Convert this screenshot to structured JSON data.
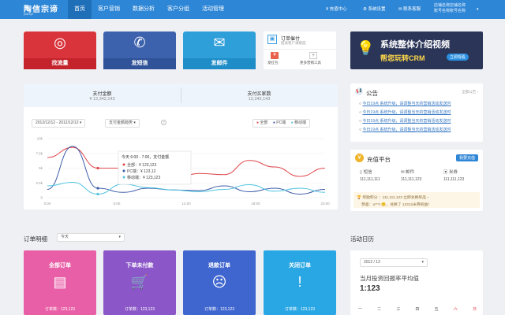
{
  "header": {
    "logo": "陶信宗谛",
    "logo_sub": "jintrepr",
    "nav": [
      "首页",
      "客户营销",
      "数据分析",
      "客户分组",
      "活动管理"
    ],
    "recharge": "充值中心",
    "settings": "系统设置",
    "contact": "联系客服",
    "user_line1": "店铺名称店铺名称",
    "user_line2": "账号名称账号名称"
  },
  "tiles": [
    {
      "label": "找流量",
      "color": "#d9343c"
    },
    {
      "label": "发短信",
      "color": "#3d62ad"
    },
    {
      "label": "发邮件",
      "color": "#2f9fd9"
    }
  ],
  "follow_card": {
    "title": "订单催付",
    "subtitle": "提高客户满意度",
    "item1": "发红包",
    "item2": "更多营销工具"
  },
  "promo": {
    "title": "系统整体介绍视频",
    "subtitle": "帮您玩转CRM",
    "button": "立即观看"
  },
  "stats": {
    "pay_amount_label": "支付金额",
    "pay_amount_value": "¥ 12,342,143",
    "buyers_label": "支付买家数",
    "buyers_value": "12,342,143"
  },
  "chart_controls": {
    "date_range": "2012/12/12 - 2012/12/12",
    "metric": "支付金额趋势",
    "legend": [
      "全部",
      "PC端",
      "移动端"
    ]
  },
  "chart_data": {
    "type": "line",
    "x": [
      "0:00",
      "6:00",
      "12:00",
      "18:00",
      "23:00"
    ],
    "y_ticks": [
      "0",
      "2.5k",
      "5k",
      "7.5k",
      "10k"
    ],
    "ylim": [
      0,
      10000
    ],
    "series": [
      {
        "name": "全部",
        "color": "#e0474c",
        "values": [
          6800,
          8500,
          5000,
          5000,
          3900,
          3000,
          4100,
          3900,
          6300,
          5200,
          3600,
          5000
        ]
      },
      {
        "name": "PC端",
        "color": "#3b5aa8",
        "values": [
          1400,
          8700,
          1600,
          900,
          1600,
          1300,
          1200,
          2000,
          1000,
          1600,
          600,
          1400
        ]
      },
      {
        "name": "移动端",
        "color": "#52c4e0",
        "values": [
          2000,
          2600,
          600,
          2300,
          1700,
          1300,
          1000,
          1400,
          2200,
          1100,
          1600,
          900
        ]
      }
    ],
    "tooltip": {
      "title": "今天 6:00 - 7:00，支付金额",
      "rows": [
        "全部：¥ 123,123",
        "PC端：¥ 123,12",
        "移动端：¥ 123,123"
      ]
    }
  },
  "notice": {
    "title": "公告",
    "more": "全部公告 ›",
    "items": [
      "今日19点 系统升级，请调整当天的营销活动发送时",
      "今日19点 系统升级，请调整当天的营销活动发送时",
      "今日19点 系统升级，请调整当天的营销活动发送时",
      "今日19点 系统升级，请调整当天的营销活动发送时"
    ]
  },
  "recharge": {
    "title": "充值平台",
    "button": "我要充值",
    "items": [
      {
        "label": "短信",
        "value": "111,111,111"
      },
      {
        "label": "邮件",
        "value": "111,111,123"
      },
      {
        "label": "米券",
        "value": "111,111,123"
      }
    ],
    "reward_line": "奖励积分 ：111,111,123  立即兑换奖品 ›",
    "user_line": "恭喜：a***t 😊，兑换了 12312米券权益！"
  },
  "order": {
    "title": "订单明细",
    "period": "今天",
    "tiles": [
      {
        "label": "全部订单",
        "icon": "▤",
        "color": "#e95fa7",
        "count": "订单数：123,123"
      },
      {
        "label": "下单未付款",
        "icon": "🛒",
        "color": "#8b56c8",
        "count": "订单数：123,123"
      },
      {
        "label": "退款订单",
        "icon": "☹",
        "color": "#3f66cf",
        "count": "订单数：123,123"
      },
      {
        "label": "关闭订单",
        "icon": "!",
        "color": "#29a7e4",
        "count": "订单数：123,123"
      }
    ]
  },
  "calendar": {
    "title": "活动日历",
    "month": "2012 / 12",
    "label": "当月投资回报率平均值",
    "value": "1:123",
    "week": [
      "一",
      "二",
      "三",
      "四",
      "五",
      "六",
      "日"
    ]
  }
}
